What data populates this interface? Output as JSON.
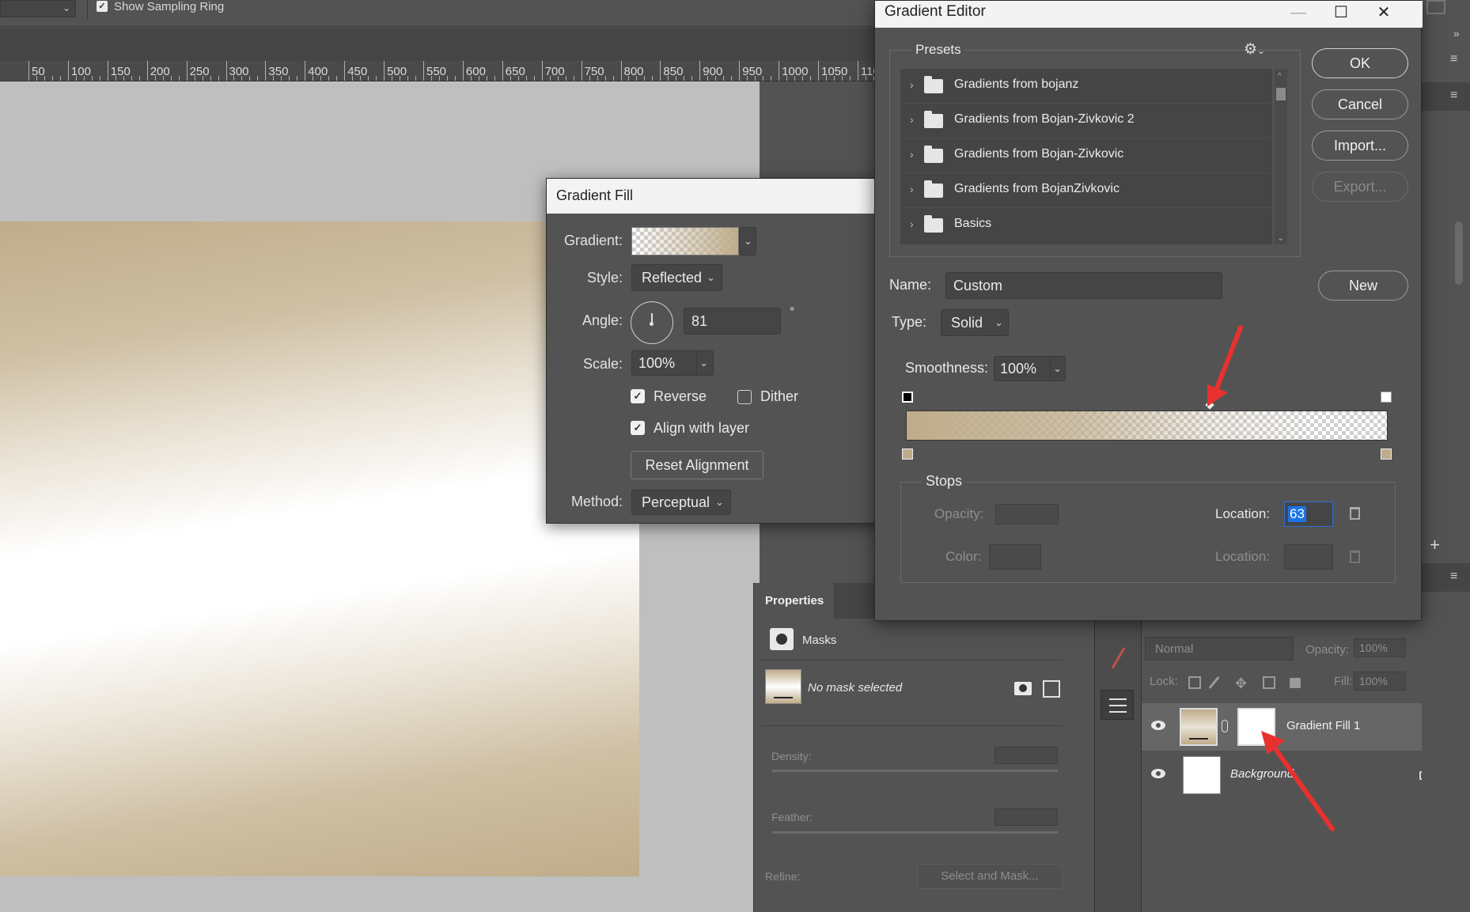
{
  "options_bar": {
    "sampling_ring_label": "Show Sampling Ring",
    "sampling_ring_checked": true
  },
  "ruler": {
    "numbers": [
      "50",
      "100",
      "150",
      "200",
      "250",
      "300",
      "350",
      "400",
      "450",
      "500",
      "550",
      "600",
      "650",
      "700",
      "750",
      "800",
      "850",
      "900",
      "950",
      "1000",
      "1050",
      "110"
    ]
  },
  "gradient_fill": {
    "title": "Gradient Fill",
    "gradient_label": "Gradient:",
    "style_label": "Style:",
    "style_value": "Reflected",
    "angle_label": "Angle:",
    "angle_value": "81",
    "degree_symbol": "°",
    "scale_label": "Scale:",
    "scale_value": "100%",
    "reverse_label": "Reverse",
    "reverse_checked": true,
    "dither_label": "Dither",
    "dither_checked": false,
    "align_label": "Align with layer",
    "align_checked": true,
    "reset_button": "Reset Alignment",
    "method_label": "Method:",
    "method_value": "Perceptual"
  },
  "gradient_editor": {
    "title": "Gradient Editor",
    "presets_label": "Presets",
    "presets": [
      "Gradients from bojanz",
      "Gradients from Bojan-Zivkovic 2",
      "Gradients from Bojan-Zivkovic",
      "Gradients from BojanZivkovic",
      "Basics"
    ],
    "buttons": {
      "ok": "OK",
      "cancel": "Cancel",
      "import": "Import...",
      "export": "Export...",
      "new": "New"
    },
    "name_label": "Name:",
    "name_value": "Custom",
    "type_label": "Type:",
    "type_value": "Solid",
    "smoothness_label": "Smoothness:",
    "smoothness_value": "100%",
    "stops_label": "Stops",
    "opacity_label": "Opacity:",
    "color_label": "Color:",
    "location_label": "Location:",
    "location_value": "63",
    "location2_label": "Location:",
    "midpoint_location": 63
  },
  "properties": {
    "tab_label": "Properties",
    "masks_label": "Masks",
    "no_mask": "No mask selected",
    "density_label": "Density:",
    "feather_label": "Feather:",
    "refine_label": "Refine:",
    "select_mask_button": "Select and Mask..."
  },
  "layers": {
    "blend_mode": "Normal",
    "opacity_label": "Opacity:",
    "opacity_value": "100%",
    "lock_label": "Lock:",
    "fill_label": "Fill:",
    "fill_value": "100%",
    "items": [
      {
        "name": "Gradient Fill 1"
      },
      {
        "name": "Background"
      }
    ]
  },
  "colors": {
    "gradient_tan": "#bfac8a",
    "annotation_red": "#e8312f",
    "accent_blue": "#1a73e8"
  }
}
